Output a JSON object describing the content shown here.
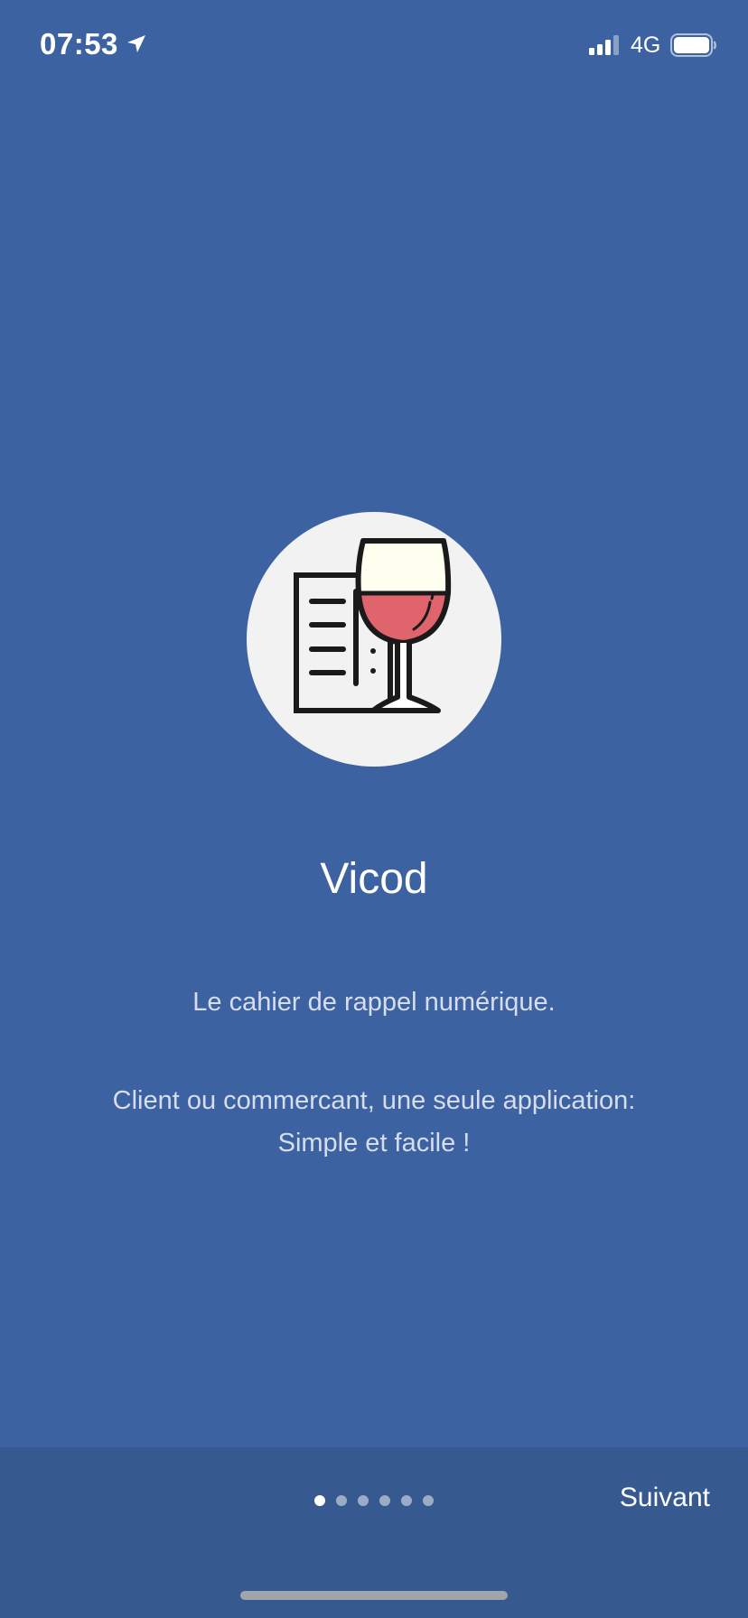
{
  "status_bar": {
    "time": "07:53",
    "network": "4G",
    "icons": [
      "location-arrow-icon",
      "signal-icon",
      "battery-icon"
    ]
  },
  "onboarding": {
    "logo_icon": "menu-wine-glass-icon",
    "title": "Vicod",
    "tagline": "Le cahier de rappel numérique.",
    "description_line1": "Client ou commercant, une seule application:",
    "description_line2": "Simple et facile !"
  },
  "pager": {
    "total_pages": 6,
    "current_page": 1
  },
  "bottom_bar": {
    "next_label": "Suivant"
  },
  "colors": {
    "background": "#3d62a1",
    "bottom_bar": "#36598f",
    "wine": "#e0646c",
    "glass_top": "#fffff0"
  }
}
